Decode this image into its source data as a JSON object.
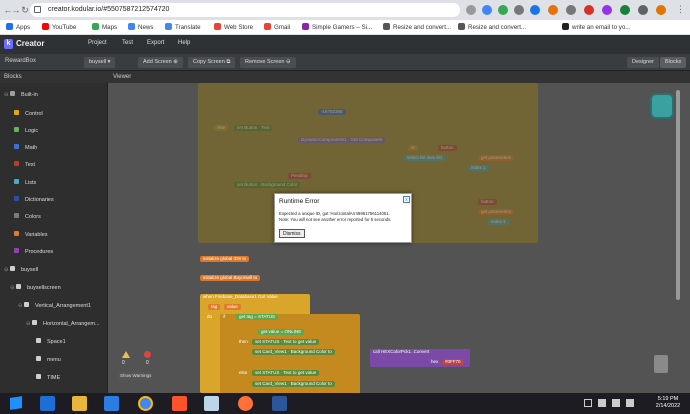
{
  "browser": {
    "url": "creator.kodular.io/#5507587212574720",
    "bookmarks": [
      "Apps",
      "YouTube",
      "Maps",
      "News",
      "Translate",
      "Web Store",
      "Gmail",
      "Simple Gamers – Si...",
      "Resize and convert...",
      "Resize and convert...",
      "write an email to yo..."
    ]
  },
  "app": {
    "brand": "Creator",
    "menu": [
      "Project",
      "Test",
      "Export",
      "Help"
    ],
    "project_name": "RewardBox",
    "screen_select": "buysell",
    "add_screen": "Add Screen",
    "copy_screen": "Copy Screen",
    "remove_screen": "Remove Screen",
    "designer": "Designer",
    "blocks_btn": "Blocks"
  },
  "panels": {
    "blocks_title": "Blocks",
    "viewer_title": "Viewer"
  },
  "tree": [
    {
      "label": "Built-in",
      "color": "#9e9e9e"
    },
    {
      "label": "Control",
      "color": "#e6a117"
    },
    {
      "label": "Logic",
      "color": "#64b45a"
    },
    {
      "label": "Math",
      "color": "#3f6fd8"
    },
    {
      "label": "Text",
      "color": "#c0392b"
    },
    {
      "label": "Lists",
      "color": "#48a9c5"
    },
    {
      "label": "Dictionaries",
      "color": "#2d4ea8"
    },
    {
      "label": "Colors",
      "color": "#7b7b7b"
    },
    {
      "label": "Variables",
      "color": "#e07b2c"
    },
    {
      "label": "Procedures",
      "color": "#8e44ad"
    },
    {
      "label": "buysell",
      "color": "#cfcfcf"
    },
    {
      "label": "buysellscreen",
      "color": "#cfcfcf"
    },
    {
      "label": "Vertical_Arrangement1",
      "color": "#cfcfcf"
    },
    {
      "label": "Horizontal_Arrangem...",
      "color": "#cfcfcf"
    },
    {
      "label": "Space1",
      "color": "#cfcfcf"
    },
    {
      "label": "menu",
      "color": "#cfcfcf"
    },
    {
      "label": "TIME",
      "color": "#cfcfcf"
    }
  ],
  "workspace": {
    "show_warnings": "Show Warnings",
    "warn_count": "0",
    "err_count": "0",
    "b_num": "-16752385",
    "b_when": "else",
    "b_set_button": "set Button",
    "b_text": "Text",
    "b_dynamic": "DynamicComponents1",
    "b_getcomp": "Get Component",
    "b_id": "id",
    "b_button": "button",
    "b_select": "select list item  list",
    "b_get": "get",
    "b_parameters": "parameters",
    "b_index": "index",
    "b_index1": "1",
    "b_pending": "Pending",
    "b_bgcolor": "Background Color",
    "b_init1": "initialize global",
    "b_init1_name": "IDS",
    "b_init2_name": "Buyorsell",
    "b_to": "to",
    "b_event": "when",
    "b_firebase": "Firebase_Database1",
    "b_gotvalue": "Got Value",
    "b_tag": "tag",
    "b_value": "value",
    "b_do": "do",
    "b_if": "if",
    "b_status": "STATUS",
    "b_eq": "=",
    "b_online": "ONLINE",
    "b_then": "then",
    "b_setstatus": "set STATUS",
    "b_card": "set Card_View1",
    "b_call": "call",
    "b_hexcolor": "HEXColorPck1",
    "b_convert": ".Convert",
    "b_hex": "hex",
    "b_hexval": "#0FF70",
    "b_else": "else"
  },
  "dialog": {
    "title": "Runtime Error",
    "line1": "Expected a unique ID, got 'HorizontalArr49961756114051.",
    "line2": "Note: You will not see another error reported for 5 seconds.",
    "dismiss": "Dismiss",
    "close": "x"
  },
  "taskbar": {
    "time": "5:19 PM",
    "date": "2/14/2022"
  }
}
